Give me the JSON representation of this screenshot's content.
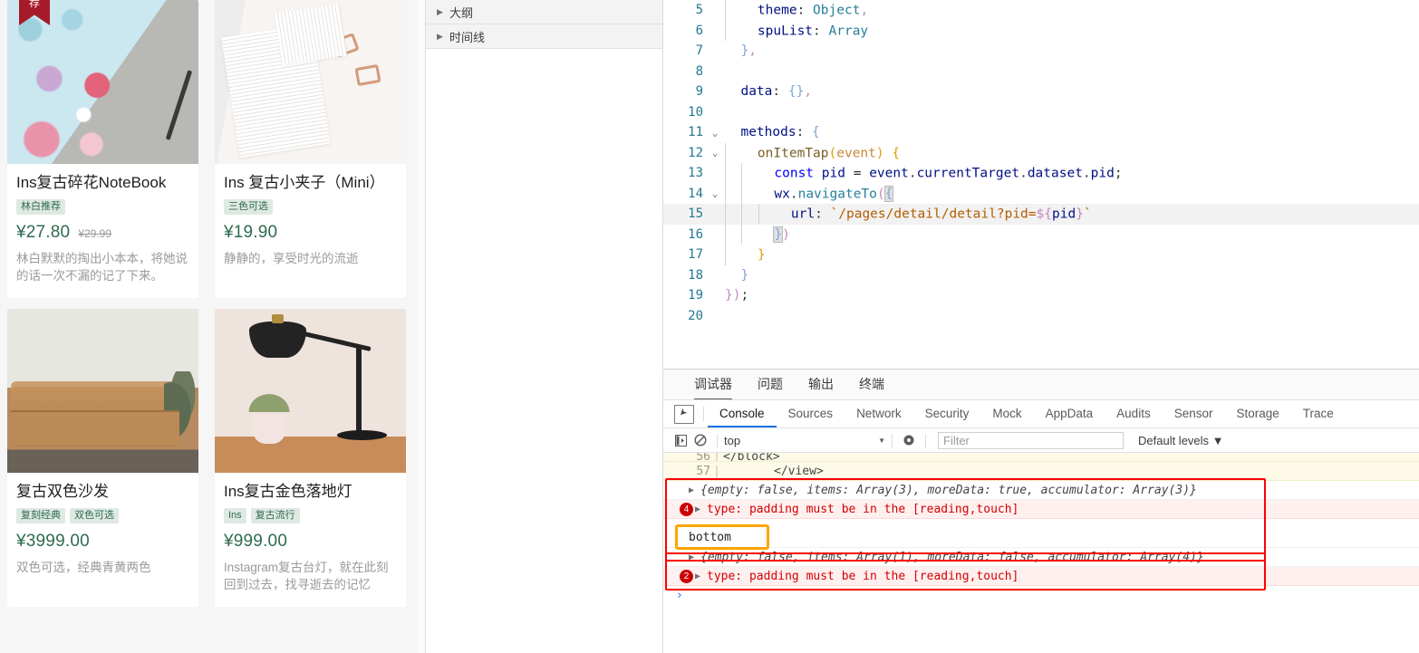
{
  "simulator": {
    "products": [
      {
        "title": "Ins复古碎花NoteBook",
        "tags": [
          "林白推荐"
        ],
        "price": "¥27.80",
        "old_price": "¥29.99",
        "desc": "林白默默的掏出小本本，将她说的话一次不漏的记了下来。",
        "ribbon": "荐",
        "image": "floral-notebook-photo"
      },
      {
        "title": "Ins 复古小夹子（Mini）",
        "tags": [
          "三色可选"
        ],
        "price": "¥19.90",
        "old_price": "",
        "desc": "静静的，享受时光的流逝",
        "ribbon": "",
        "image": "notepad-clips-photo"
      },
      {
        "title": "复古双色沙发",
        "tags": [
          "复刻经典",
          "双色可选"
        ],
        "price": "¥3999.00",
        "old_price": "",
        "desc": "双色可选，经典青黄两色",
        "ribbon": "",
        "image": "leather-sofa-photo"
      },
      {
        "title": "Ins复古金色落地灯",
        "tags": [
          "Ins",
          "复古流行"
        ],
        "price": "¥999.00",
        "old_price": "",
        "desc": "Instagram复古台灯，就在此刻回到过去，找寻逝去的记忆",
        "ribbon": "",
        "image": "desk-lamp-photo"
      }
    ]
  },
  "midpanel": {
    "sections": [
      {
        "label": "大纲",
        "expanded": false
      },
      {
        "label": "时间线",
        "expanded": false
      }
    ]
  },
  "editor": {
    "lines": [
      {
        "num": "5",
        "fold": "",
        "indent": 2,
        "text": "    theme: Object,"
      },
      {
        "num": "6",
        "fold": "",
        "indent": 2,
        "text": "    spuList: Array"
      },
      {
        "num": "7",
        "fold": "",
        "indent": 1,
        "text": "  },"
      },
      {
        "num": "8",
        "fold": "",
        "indent": 0,
        "text": ""
      },
      {
        "num": "9",
        "fold": "",
        "indent": 1,
        "text": "  data: {},"
      },
      {
        "num": "10",
        "fold": "",
        "indent": 0,
        "text": ""
      },
      {
        "num": "11",
        "fold": "v",
        "indent": 1,
        "text": "  methods: {"
      },
      {
        "num": "12",
        "fold": "v",
        "indent": 2,
        "text": "    onItemTap(event) {"
      },
      {
        "num": "13",
        "fold": "",
        "indent": 3,
        "text": "      const pid = event.currentTarget.dataset.pid;"
      },
      {
        "num": "14",
        "fold": "v",
        "indent": 3,
        "text": "      wx.navigateTo({"
      },
      {
        "num": "15",
        "fold": "",
        "indent": 4,
        "text": "        url: `/pages/detail/detail?pid=${pid}`",
        "selected": true
      },
      {
        "num": "16",
        "fold": "",
        "indent": 3,
        "text": "      })"
      },
      {
        "num": "17",
        "fold": "",
        "indent": 2,
        "text": "    }"
      },
      {
        "num": "18",
        "fold": "",
        "indent": 1,
        "text": "  }"
      },
      {
        "num": "19",
        "fold": "",
        "indent": 0,
        "text": "});"
      },
      {
        "num": "20",
        "fold": "",
        "indent": 0,
        "text": ""
      }
    ]
  },
  "devtools": {
    "panel_tabs": [
      {
        "label": "调试器",
        "active": true
      },
      {
        "label": "问题",
        "active": false
      },
      {
        "label": "输出",
        "active": false
      },
      {
        "label": "终端",
        "active": false
      }
    ],
    "chrome_tabs": [
      {
        "label": "Console",
        "active": true
      },
      {
        "label": "Sources",
        "active": false
      },
      {
        "label": "Network",
        "active": false
      },
      {
        "label": "Security",
        "active": false
      },
      {
        "label": "Mock",
        "active": false
      },
      {
        "label": "AppData",
        "active": false
      },
      {
        "label": "Audits",
        "active": false
      },
      {
        "label": "Sensor",
        "active": false
      },
      {
        "label": "Storage",
        "active": false
      },
      {
        "label": "Trace",
        "active": false
      }
    ],
    "toolbar": {
      "context": "top",
      "filter_placeholder": "Filter",
      "levels": "Default levels",
      "caret": "▼"
    },
    "messages": [
      {
        "kind": "code",
        "line_no": "56",
        "text": "</block>",
        "partial": true
      },
      {
        "kind": "code",
        "line_no": "57",
        "text": "</view>",
        "partial": false
      },
      {
        "kind": "log",
        "count": "",
        "text": "{empty: false, items: Array(3), moreData: true, accumulator: Array(3)}"
      },
      {
        "kind": "err",
        "count": "4",
        "text": "type: padding must be in the [reading,touch]"
      },
      {
        "kind": "log",
        "count": "",
        "text": "{empty: false, items: Array(1), moreData: false, accumulator: Array(4)}"
      },
      {
        "kind": "err",
        "count": "2",
        "text": "type: padding must be in the [reading,touch]"
      }
    ],
    "tooltip": {
      "text": "bottom"
    },
    "prompt": "›"
  },
  "colors": {
    "accent_blue": "#1a73e8",
    "tag_green": "#2f6b50",
    "tag_bg": "#dfe9e3",
    "error_red": "#d40000",
    "highlight_red": "#ff0000",
    "highlight_orange": "#ffa500",
    "ribbon_red": "#a61b29"
  }
}
